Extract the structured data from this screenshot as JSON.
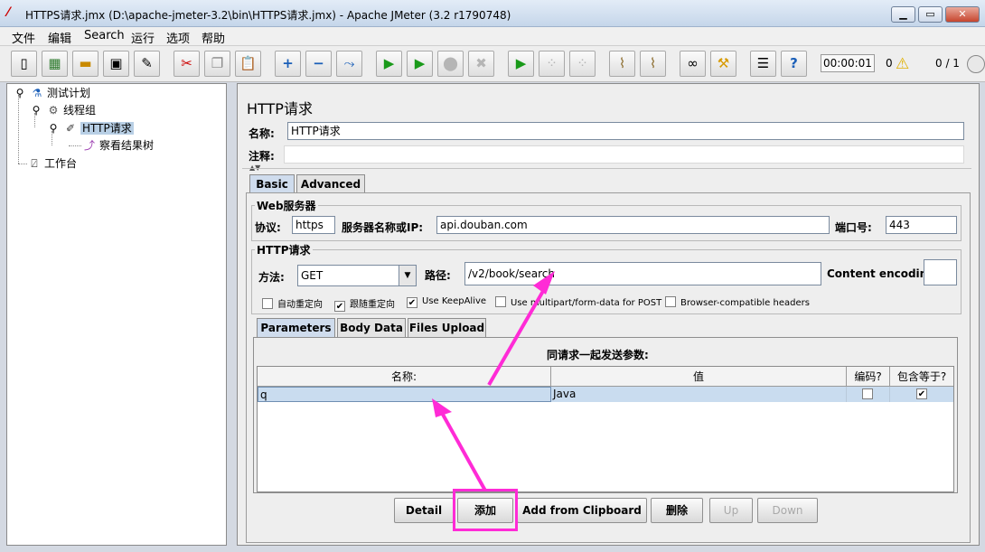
{
  "window": {
    "title": "HTTPS请求.jmx (D:\\apache-jmeter-3.2\\bin\\HTTPS请求.jmx) - Apache JMeter (3.2 r1790748)"
  },
  "menu": [
    "文件",
    "编辑",
    "Search",
    "运行",
    "选项",
    "帮助"
  ],
  "toolbar": {
    "timer": "00:00:01",
    "warnings": "0",
    "threads": "0 / 1"
  },
  "tree": {
    "items": [
      {
        "label": "测试计划"
      },
      {
        "label": "线程组"
      },
      {
        "label": "HTTP请求"
      },
      {
        "label": "察看结果树"
      },
      {
        "label": "工作台"
      }
    ]
  },
  "panel": {
    "title": "HTTP请求",
    "name_label": "名称:",
    "name_value": "HTTP请求",
    "comment_label": "注释:",
    "tabs": [
      "Basic",
      "Advanced"
    ],
    "web_server": {
      "title": "Web服务器",
      "protocol_label": "协议:",
      "protocol_value": "https",
      "server_label": "服务器名称或IP:",
      "server_value": "api.douban.com",
      "port_label": "端口号:",
      "port_value": "443"
    },
    "http_request": {
      "title": "HTTP请求",
      "method_label": "方法:",
      "method_value": "GET",
      "path_label": "路径:",
      "path_value": "/v2/book/search",
      "encoding_label": "Content encoding:",
      "checkboxes": [
        {
          "label": "自动重定向",
          "checked": false
        },
        {
          "label": "跟随重定向",
          "checked": true
        },
        {
          "label": "Use KeepAlive",
          "checked": true
        },
        {
          "label": "Use multipart/form-data for POST",
          "checked": false
        },
        {
          "label": "Browser-compatible headers",
          "checked": false
        }
      ]
    },
    "sub_tabs": [
      "Parameters",
      "Body Data",
      "Files Upload"
    ],
    "params_caption": "同请求一起发送参数:",
    "table": {
      "headers": [
        "名称:",
        "值",
        "编码?",
        "包含等于?"
      ],
      "rows": [
        {
          "name": "q",
          "value": "Java",
          "encode": false,
          "include_equals": true
        }
      ]
    },
    "buttons": [
      "Detail",
      "添加",
      "Add from Clipboard",
      "删除",
      "Up",
      "Down"
    ]
  },
  "annotation": {
    "color": "#ff2bd6"
  }
}
